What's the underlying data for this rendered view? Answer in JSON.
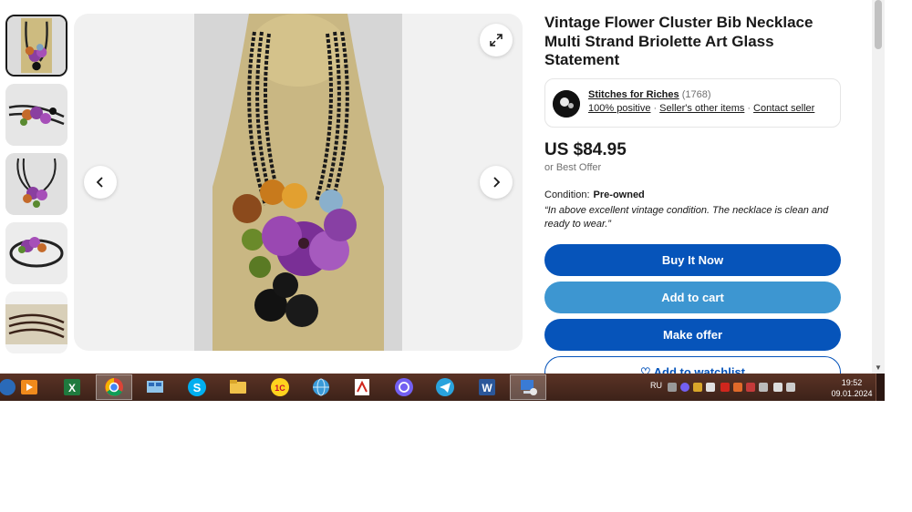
{
  "product": {
    "title": "Vintage Flower Cluster Bib Necklace Multi Strand Briolette Art Glass Statement",
    "price": "US $84.95",
    "best_offer": "or Best Offer",
    "condition_label": "Condition:",
    "condition_value": "Pre-owned",
    "condition_note": "“In above excellent vintage condition. The necklace is clean and ready to wear.”"
  },
  "gallery": {
    "thumbnail_count": 5,
    "selected_index": 0
  },
  "seller": {
    "name": "Stitches for Riches",
    "feedback_count": "(1768)",
    "positive": "100% positive",
    "other_items": "Seller's other items",
    "contact": "Contact seller"
  },
  "buttons": {
    "buy_now": "Buy It Now",
    "add_to_cart": "Add to cart",
    "make_offer": "Make offer",
    "watchlist": "Add to watchlist"
  },
  "colors": {
    "primary": "#0654ba",
    "secondary": "#3d96d1",
    "text": "#191919",
    "muted": "#707070",
    "taskbar": "#4a2a1f"
  },
  "taskbar": {
    "apps": [
      "media-player",
      "excel",
      "chrome",
      "remote-desktop",
      "skype",
      "file-explorer",
      "1c",
      "network-globe",
      "pdf-reader",
      "viber",
      "telegram",
      "word",
      "remote-connection"
    ],
    "active_app": "chrome",
    "language": "RU",
    "time": "19:52",
    "date": "09.01.2024"
  }
}
